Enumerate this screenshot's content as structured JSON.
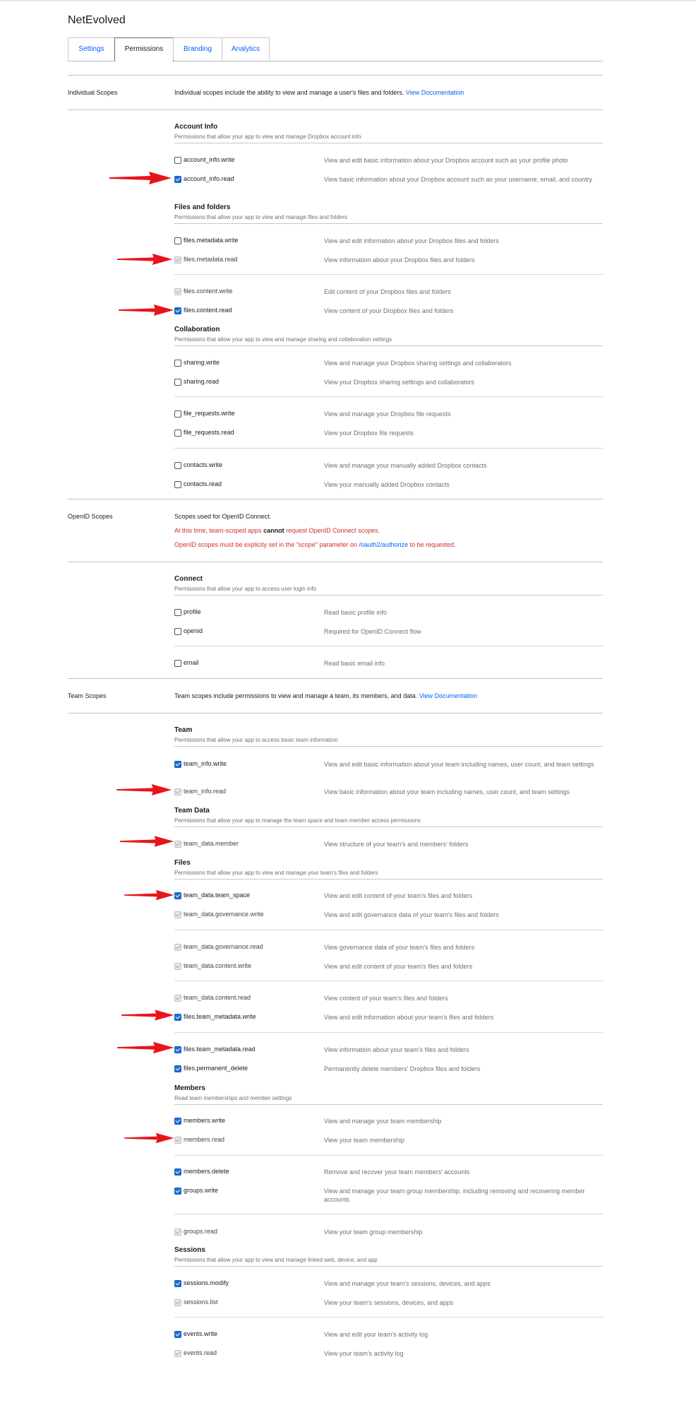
{
  "app": {
    "title": "NetEvolved"
  },
  "tabs": [
    "Settings",
    "Permissions",
    "Branding",
    "Analytics"
  ],
  "individual": {
    "label": "Individual Scopes",
    "desc": "Individual scopes include the ability to view and manage a user's files and folders.",
    "link": "View Documentation",
    "account_info": {
      "title": "Account Info",
      "desc": "Permissions that allow your app to view and manage Dropbox account info",
      "scopes": [
        {
          "name": "account_info.write",
          "desc": "View and edit basic information about your Dropbox account such as your profile photo",
          "state": "off"
        },
        {
          "name": "account_info.read",
          "desc": "View basic information about your Dropbox account such as your username, email, and country",
          "state": "on"
        }
      ]
    },
    "files": {
      "title": "Files and folders",
      "desc": "Permissions that allow your app to view and manage files and folders",
      "scopes": [
        {
          "name": "files.metadata.write",
          "desc": "View and edit information about your Dropbox files and folders",
          "state": "off"
        },
        {
          "name": "files.metadata.read",
          "desc": "View information about your Dropbox files and folders",
          "state": "disabled"
        },
        {
          "name": "files.content.write",
          "desc": "Edit content of your Dropbox files and folders",
          "state": "disabled"
        },
        {
          "name": "files.content.read",
          "desc": "View content of your Dropbox files and folders",
          "state": "on"
        }
      ]
    },
    "collaboration": {
      "title": "Collaboration",
      "desc": "Permissions that allow your app to view and manage sharing and collaboration settings",
      "scopes": [
        {
          "name": "sharing.write",
          "desc": "View and manage your Dropbox sharing settings and collaborators",
          "state": "off"
        },
        {
          "name": "sharing.read",
          "desc": "View your Dropbox sharing settings and collaborators",
          "state": "off"
        },
        {
          "name": "file_requests.write",
          "desc": "View and manage your Dropbox file requests",
          "state": "off"
        },
        {
          "name": "file_requests.read",
          "desc": "View your Dropbox file requests",
          "state": "off"
        },
        {
          "name": "contacts.write",
          "desc": "View and manage your manually added Dropbox contacts",
          "state": "off"
        },
        {
          "name": "contacts.read",
          "desc": "View your manually added Dropbox contacts",
          "state": "off"
        }
      ]
    }
  },
  "openid": {
    "label": "OpenID Scopes",
    "desc": "Scopes used for OpenID Connect.",
    "warn1_pre": "At this time, team-scoped apps ",
    "warn1_bold": "cannot",
    "warn1_post": " request OpenID Connect scopes.",
    "warn2_pre": "OpenID scopes must be explicity set in the \"scope\" parameter on ",
    "warn2_link": "/oauth2/authorize",
    "warn2_post": " to be requested.",
    "connect": {
      "title": "Connect",
      "desc": "Permissions that allow your app to access user login info",
      "scopes": [
        {
          "name": "profile",
          "desc": "Read basic profile info",
          "state": "off"
        },
        {
          "name": "openid",
          "desc": "Required for OpenID Connect flow",
          "state": "off"
        },
        {
          "name": "email",
          "desc": "Read basic email info",
          "state": "off"
        }
      ]
    }
  },
  "team": {
    "label": "Team Scopes",
    "desc": "Team scopes include permissions to view and manage a team, its members, and data.",
    "link": "View Documentation",
    "team": {
      "title": "Team",
      "desc": "Permissions that allow your app to access basic team information",
      "scopes": [
        {
          "name": "team_info.write",
          "desc": "View and edit basic information about your team including names, user count, and team settings",
          "state": "on"
        },
        {
          "name": "team_info.read",
          "desc": "View basic information about your team including names, user count, and team settings",
          "state": "disabled"
        }
      ]
    },
    "team_data": {
      "title": "Team Data",
      "desc": "Permissions that allow your app to manage the team space and team member access permissions",
      "scopes": [
        {
          "name": "team_data.member",
          "desc": "View structure of your team's and members' folders",
          "state": "disabled"
        }
      ]
    },
    "files": {
      "title": "Files",
      "desc": "Permissions that allow your app to view and manage your team's files and folders",
      "scopes": [
        {
          "name": "team_data.team_space",
          "desc": "View and edit content of your team's files and folders",
          "state": "on"
        },
        {
          "name": "team_data.governance.write",
          "desc": "View and edit governance data of your team's files and folders",
          "state": "disabled"
        },
        {
          "name": "team_data.governance.read",
          "desc": "View governance data of your team's files and folders",
          "state": "disabled"
        },
        {
          "name": "team_data.content.write",
          "desc": "View and edit content of your team's files and folders",
          "state": "disabled"
        },
        {
          "name": "team_data.content.read",
          "desc": "View content of your team's files and folders",
          "state": "disabled"
        },
        {
          "name": "files.team_metadata.write",
          "desc": "View and edit information about your team's files and folders",
          "state": "on"
        },
        {
          "name": "files.team_metadata.read",
          "desc": "View information about your team's files and folders",
          "state": "on"
        },
        {
          "name": "files.permanent_delete",
          "desc": "Permanently delete members' Dropbox files and folders",
          "state": "on"
        }
      ]
    },
    "members": {
      "title": "Members",
      "desc": "Read team memberships and member settings",
      "scopes": [
        {
          "name": "members.write",
          "desc": "View and manage your team membership",
          "state": "on"
        },
        {
          "name": "members.read",
          "desc": "View your team membership",
          "state": "disabled"
        },
        {
          "name": "members.delete",
          "desc": "Remove and recover your team members' accounts",
          "state": "on"
        },
        {
          "name": "groups.write",
          "desc": "View and manage your team group membership, including removing and recovering member accounts",
          "state": "on"
        },
        {
          "name": "groups.read",
          "desc": "View your team group membership",
          "state": "disabled"
        }
      ]
    },
    "sessions": {
      "title": "Sessions",
      "desc": "Permissions that allow your app to view and manage linked web, device, and app",
      "scopes": [
        {
          "name": "sessions.modify",
          "desc": "View and manage your team's sessions, devices, and apps",
          "state": "on"
        },
        {
          "name": "sessions.list",
          "desc": "View your team's sessions, devices, and apps",
          "state": "disabled"
        },
        {
          "name": "events.write",
          "desc": "View and edit your team's activity log",
          "state": "on"
        },
        {
          "name": "events.read",
          "desc": "View your team's activity log",
          "state": "disabled"
        }
      ]
    }
  },
  "colors": {
    "link": "#0061fe",
    "checked": "#1a6cdb",
    "warning": "#d12c2c",
    "arrow": "#e8141b"
  }
}
